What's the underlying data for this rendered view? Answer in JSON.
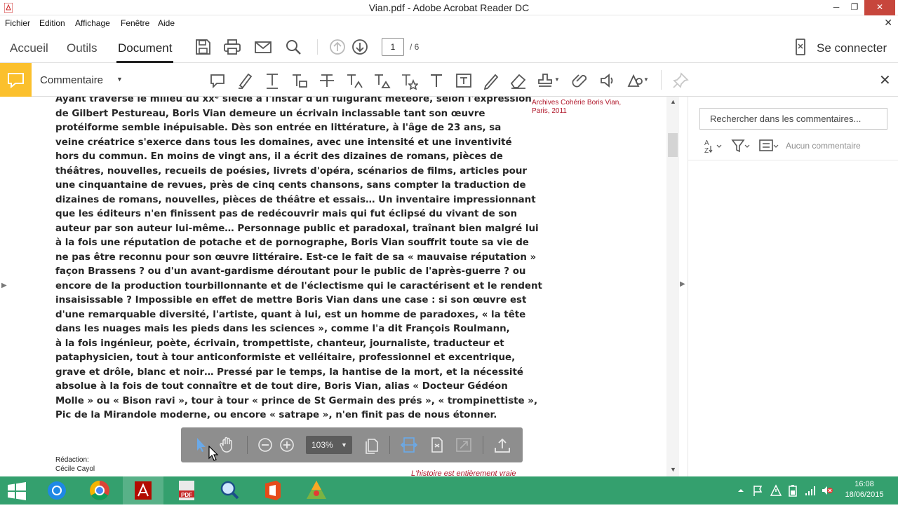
{
  "window": {
    "title": "Vian.pdf - Adobe Acrobat Reader DC",
    "minimize": "─",
    "maximize": "❐",
    "close": "✕"
  },
  "menu": {
    "items": [
      "Fichier",
      "Edition",
      "Affichage",
      "Fenêtre",
      "Aide"
    ],
    "close": "✕"
  },
  "toolbar": {
    "tabs": [
      "Accueil",
      "Outils",
      "Document"
    ],
    "active_tab": "Document",
    "page_current": "1",
    "page_total": "/ 6",
    "connect_label": "Se connecter"
  },
  "comment_bar": {
    "label": "Commentaire",
    "accent": "#fbc02d",
    "close": "✕"
  },
  "document": {
    "lines": [
      "Ayant traversé le milieu du xxᵉ siècle à l'instar d'un fulgurant météore, selon l'expression",
      "de Gilbert Pestureau, Boris Vian demeure un écrivain inclassable tant son œuvre",
      "protéiforme semble inépuisable. Dès son entrée en littérature, à l'âge de 23 ans, sa",
      "veine créatrice s'exerce dans tous les domaines, avec une intensité et une inventivité",
      "hors du commun. En moins de vingt ans, il a écrit des dizaines de romans, pièces de",
      "théâtres, nouvelles, recueils de poésies, livrets d'opéra, scénarios de films, articles pour",
      "une cinquantaine de revues, près de cinq cents chansons, sans compter la traduction de",
      "dizaines de romans, nouvelles, pièces de théâtre et essais… Un inventaire impressionnant",
      "que les éditeurs n'en finissent pas de redécouvrir mais qui fut éclipsé du vivant de son",
      "auteur par son auteur lui-même… Personnage public et paradoxal, traînant bien malgré lui",
      "à la fois une réputation de potache et de pornographe, Boris Vian souffrit toute sa vie de",
      "ne pas être reconnu pour son œuvre littéraire. Est-ce le fait de sa « mauvaise réputation »",
      "façon Brassens ? ou d'un avant-gardisme déroutant pour le public de l'après-guerre ? ou",
      "encore de la production tourbillonnante et de l'éclectisme qui le caractérisent et le rendent",
      "insaisissable ? Impossible en effet de mettre Boris Vian dans une case : si son œuvre est",
      "d'une remarquable diversité, l'artiste, quant à lui, est un homme de paradoxes, « la tête",
      "dans les nuages mais les pieds dans les sciences », comme l'a dit François Roulmann,",
      "à la fois ingénieur, poète, écrivain, trompettiste, chanteur, journaliste, traducteur et",
      "pataphysicien, tout à tour anticonformiste et velléitaire, professionnel et excentrique,",
      "grave et drôle, blanc et noir… Pressé par le temps, la hantise de la mort, et la nécessité",
      "absolue à la fois de tout connaître et de tout dire, Boris Vian, alias « Docteur Gédéon",
      "Molle » ou « Bison ravi », tour à tour « prince de St Germain des prés », « trompinettiste »,",
      "Pic de la Mirandole moderne, ou encore « satrape », n'en finit pas de nous étonner."
    ],
    "caption": "Archives Cohérie Boris Vian, Paris, 2011",
    "redaction_label": "Rédaction:",
    "redaction_name": "Cécile Cayol",
    "footer": "L'histoire est entièrement vraie"
  },
  "float_toolbar": {
    "zoom": "103%"
  },
  "comments_panel": {
    "search_placeholder": "Rechercher dans les commentaires...",
    "empty_label": "Aucun commentaire"
  },
  "taskbar": {
    "time": "16:08",
    "date": "18/06/2015",
    "color": "#34a06e"
  }
}
